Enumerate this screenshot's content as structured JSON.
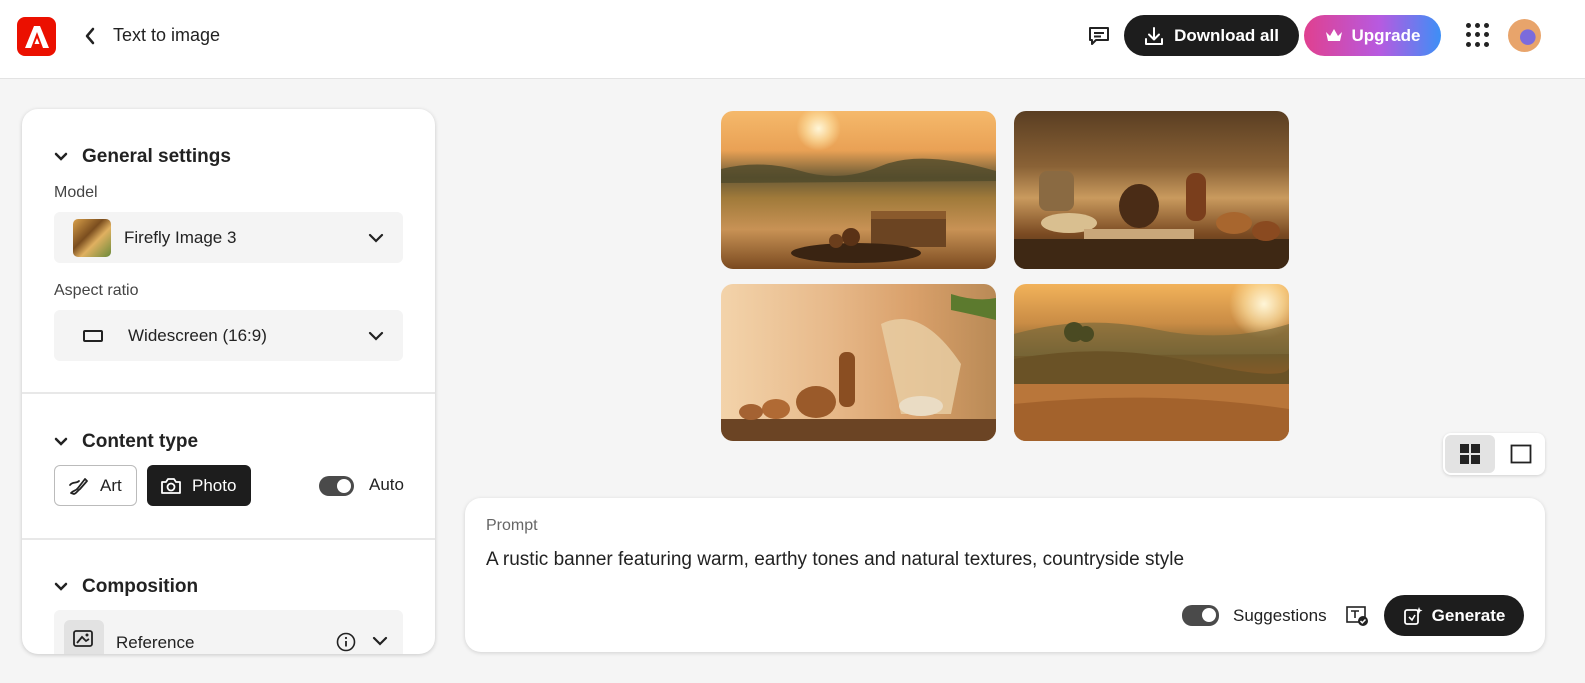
{
  "header": {
    "app_logo_letter": "A",
    "page_title": "Text to image",
    "download_all_label": "Download all",
    "upgrade_label": "Upgrade",
    "brand_color": "#eb1000"
  },
  "panel": {
    "general": {
      "title": "General settings",
      "model_label": "Model",
      "model_value": "Firefly Image 3",
      "aspect_label": "Aspect ratio",
      "aspect_value": "Widescreen (16:9)"
    },
    "content_type": {
      "title": "Content type",
      "art_label": "Art",
      "photo_label": "Photo",
      "selected": "Photo",
      "auto_label": "Auto",
      "auto_on": true
    },
    "composition": {
      "title": "Composition",
      "reference_label": "Reference"
    }
  },
  "results": {
    "images": [
      {
        "subject": "wheat field at sunset with wooden crate"
      },
      {
        "subject": "rustic table with bread, pottery and wheat"
      },
      {
        "subject": "clay pots and dried grass in wooden room"
      },
      {
        "subject": "golden rolling hills countryside"
      }
    ],
    "view_mode": "grid"
  },
  "prompt": {
    "label": "Prompt",
    "text": "A rustic banner featuring warm, earthy tones and natural textures, countryside style",
    "suggestions_label": "Suggestions",
    "suggestions_on": true,
    "generate_label": "Generate"
  }
}
